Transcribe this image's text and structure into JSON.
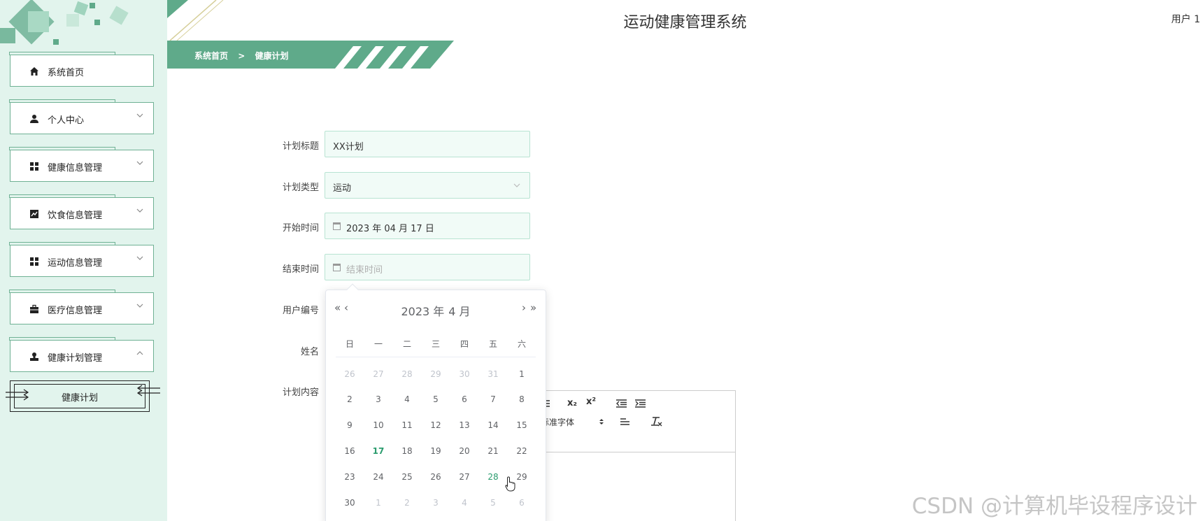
{
  "app": {
    "title": "运动健康管理系统",
    "user": "用户 1"
  },
  "breadcrumb": {
    "home": "系统首页",
    "separator": ">",
    "current": "健康计划"
  },
  "sidebar": {
    "items": [
      {
        "label": "系统首页",
        "icon": "home-icon",
        "expandable": false
      },
      {
        "label": "个人中心",
        "icon": "person-icon",
        "expandable": true
      },
      {
        "label": "健康信息管理",
        "icon": "grid-icon",
        "expandable": true
      },
      {
        "label": "饮食信息管理",
        "icon": "chart-icon",
        "expandable": true
      },
      {
        "label": "运动信息管理",
        "icon": "grid-icon",
        "expandable": true
      },
      {
        "label": "医疗信息管理",
        "icon": "briefcase-icon",
        "expandable": true
      },
      {
        "label": "健康计划管理",
        "icon": "stamp-icon",
        "expandable": true,
        "expanded": true
      }
    ],
    "subitem": "健康计划"
  },
  "form": {
    "title_label": "计划标题",
    "title_value": "XX计划",
    "type_label": "计划类型",
    "type_value": "运动",
    "start_label": "开始时间",
    "start_value": "2023 年 04 月 17 日",
    "end_label": "结束时间",
    "end_placeholder": "结束时间",
    "userno_label": "用户编号",
    "name_label": "姓名",
    "content_label": "计划内容"
  },
  "editor": {
    "font_select": "标准字体",
    "subscript": "x₂",
    "superscript": "x²"
  },
  "datepicker": {
    "year": "2023 年",
    "month": "4 月",
    "prev_year": "«",
    "prev_month": "‹",
    "next_month": "›",
    "next_year": "»",
    "weekdays": [
      "日",
      "一",
      "二",
      "三",
      "四",
      "五",
      "六"
    ],
    "days": [
      [
        "26",
        "27",
        "28",
        "29",
        "30",
        "31",
        "1"
      ],
      [
        "2",
        "3",
        "4",
        "5",
        "6",
        "7",
        "8"
      ],
      [
        "9",
        "10",
        "11",
        "12",
        "13",
        "14",
        "15"
      ],
      [
        "16",
        "17",
        "18",
        "19",
        "20",
        "21",
        "22"
      ],
      [
        "23",
        "24",
        "25",
        "26",
        "27",
        "28",
        "29"
      ],
      [
        "30",
        "1",
        "2",
        "3",
        "4",
        "5",
        "6"
      ]
    ],
    "today": "17",
    "hover": "28"
  },
  "watermark": "CSDN @计算机毕设程序设计",
  "colors": {
    "accent": "#5faa8a",
    "sidebar_bg": "#e2f4ed",
    "today": "#2b9c6e"
  }
}
